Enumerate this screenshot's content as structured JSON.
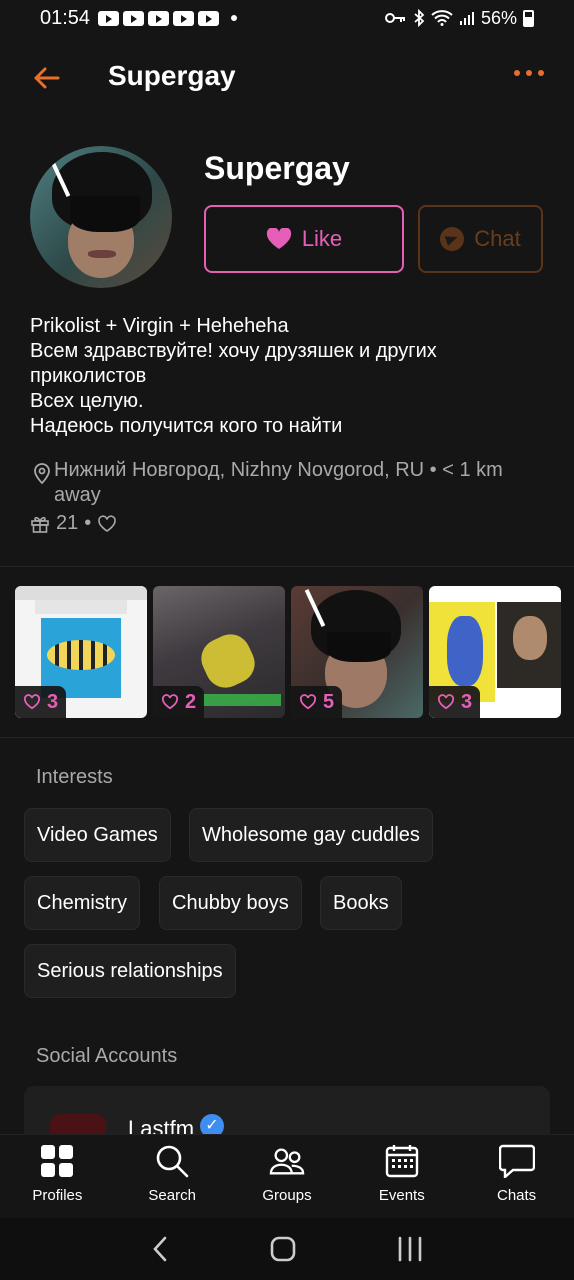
{
  "status_bar": {
    "time": "01:54",
    "battery_text": "56%",
    "icons": [
      "youtube-icon",
      "youtube-icon",
      "youtube-icon",
      "youtube-icon",
      "youtube-icon",
      "key-icon",
      "bluetooth-icon",
      "wifi-icon",
      "signal-icon",
      "battery-icon"
    ]
  },
  "app_bar": {
    "title": "Supergay",
    "back_icon": "arrow-left-icon",
    "more_icon": "more-dots-icon"
  },
  "profile": {
    "name": "Supergay",
    "like_label": "Like",
    "chat_label": "Chat",
    "bio_lines": [
      "Prikolist + Virgin + Heheheha",
      "Всем здравствуйте! хочу друзяшек и других",
      "приколистов",
      "Всех целую.",
      "Надеюсь получится кого то найти"
    ],
    "location": "Нижний Новгород, Nizhny Novgorod, RU • < 1 km away",
    "gifts_count": "21",
    "gift_separator": "•"
  },
  "photos": [
    {
      "likes": "3"
    },
    {
      "likes": "2"
    },
    {
      "likes": "5"
    },
    {
      "likes": "3"
    }
  ],
  "interests": {
    "title": "Interests",
    "items": [
      "Video Games",
      "Wholesome gay cuddles",
      "Chemistry",
      "Chubby boys",
      "Books",
      "Serious relationships"
    ]
  },
  "social": {
    "title": "Social Accounts",
    "accounts": [
      {
        "name": "Lastfm"
      }
    ]
  },
  "bottom_nav": {
    "items": [
      {
        "label": "Profiles",
        "icon": "grid-icon"
      },
      {
        "label": "Search",
        "icon": "search-icon"
      },
      {
        "label": "Groups",
        "icon": "people-icon"
      },
      {
        "label": "Events",
        "icon": "calendar-icon"
      },
      {
        "label": "Chats",
        "icon": "chat-bubble-icon"
      }
    ]
  },
  "colors": {
    "accent_orange": "#e86f2c",
    "like_pink": "#e55fb8",
    "background": "#151515"
  }
}
